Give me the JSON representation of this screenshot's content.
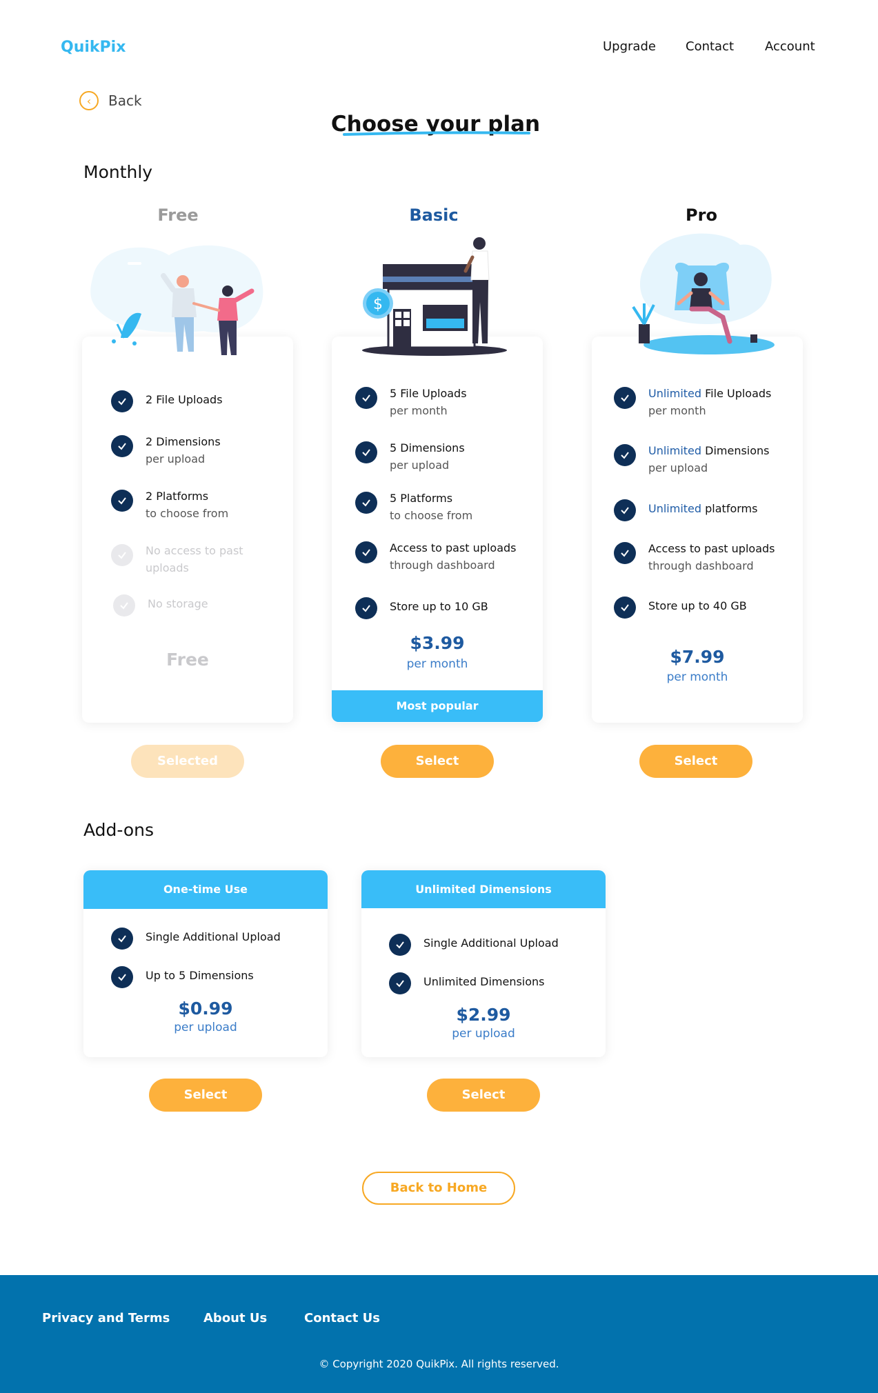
{
  "brand": {
    "logo": "QuikPix",
    "accent": "#35b8f0"
  },
  "nav": {
    "upgrade": "Upgrade",
    "contact": "Contact",
    "account": "Account"
  },
  "back": {
    "label": "Back",
    "icon": "chevron-left-icon"
  },
  "title": "Choose your plan",
  "monthly_label": "Monthly",
  "plans": [
    {
      "name": "Free",
      "features": [
        {
          "main": "2 File Uploads",
          "sub": ""
        },
        {
          "main": "2 Dimensions",
          "sub": "per upload"
        },
        {
          "main": "2 Platforms",
          "sub": "to choose from"
        },
        {
          "main": "No access to past",
          "sub": "uploads"
        },
        {
          "main": "No storage",
          "sub": ""
        }
      ],
      "price": "Free",
      "button": "Selected"
    },
    {
      "name": "Basic",
      "features": [
        {
          "main": "5 File Uploads",
          "sub": "per month"
        },
        {
          "main": "5  Dimensions",
          "sub": "per upload"
        },
        {
          "main": "5 Platforms",
          "sub": "to choose from"
        },
        {
          "main": "Access to past uploads",
          "sub": "through dashboard"
        },
        {
          "main": "Store up to 10 GB",
          "sub": ""
        }
      ],
      "price": "$3.99",
      "price_sub": "per month",
      "badge": "Most popular",
      "button": "Select"
    },
    {
      "name": "Pro",
      "features": [
        {
          "hl": "Unlimited",
          "main": " File Uploads",
          "sub": "per month"
        },
        {
          "hl": "Unlimited",
          "main": " Dimensions",
          "sub": "per upload"
        },
        {
          "hl": "Unlimited",
          "main": " platforms",
          "sub": ""
        },
        {
          "main": "Access to past uploads",
          "sub": "through dashboard"
        },
        {
          "main": "Store up to 40 GB",
          "sub": ""
        }
      ],
      "price": "$7.99",
      "price_sub": "per month",
      "button": "Select"
    }
  ],
  "addons_label": "Add-ons",
  "addons": [
    {
      "title": "One-time Use",
      "features": [
        "Single Additional Upload",
        "Up to 5 Dimensions"
      ],
      "price": "$0.99",
      "price_sub": "per upload",
      "button": "Select"
    },
    {
      "title": "Unlimited Dimensions",
      "features": [
        "Single Additional Upload",
        "Unlimited Dimensions"
      ],
      "price": "$2.99",
      "price_sub": "per upload",
      "button": "Select"
    }
  ],
  "back_home": "Back to Home",
  "footer": {
    "privacy": "Privacy and Terms",
    "about": "About Us",
    "contact": "Contact Us",
    "copyright": "© Copyright 2020 QuikPix. All rights reserved."
  },
  "colors": {
    "button": "#fdb13c",
    "button_disabled": "#fde3bb",
    "banner": "#39bdf8",
    "check": "#0e2f57",
    "price": "#1e5aa0",
    "footer": "#0272ad"
  }
}
